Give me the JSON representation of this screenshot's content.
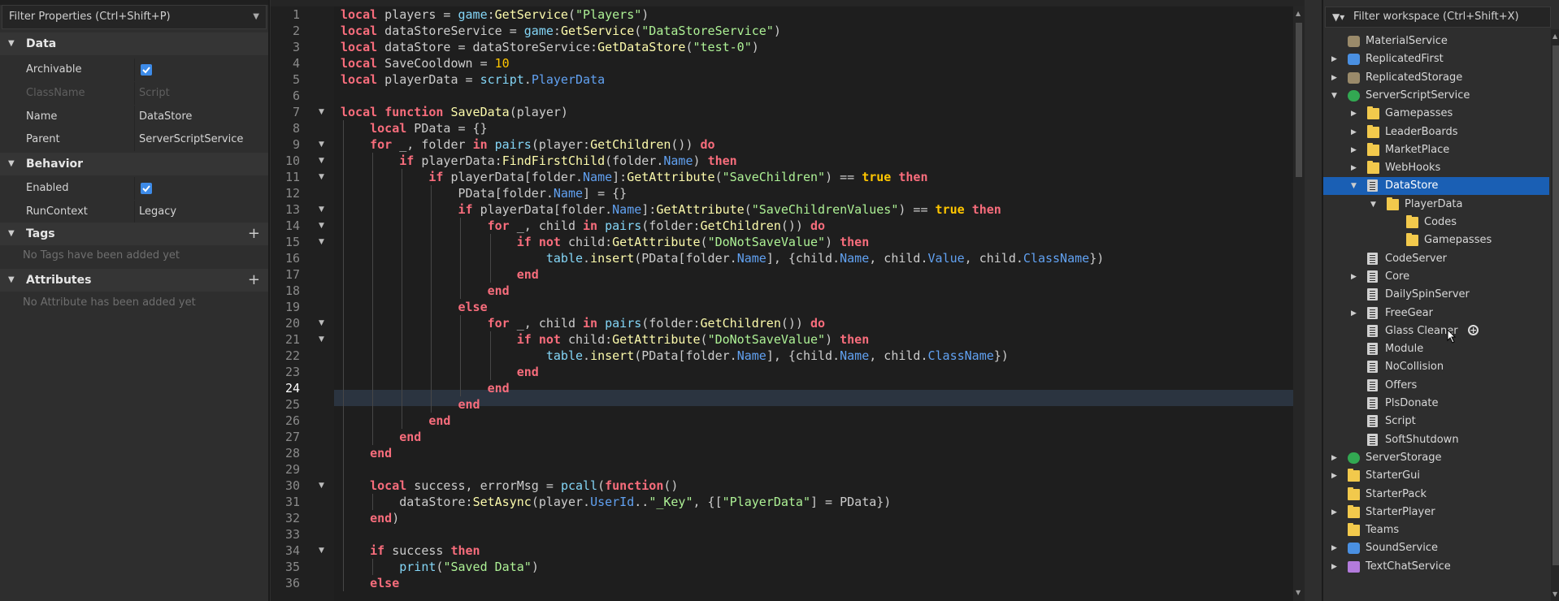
{
  "properties": {
    "filter_placeholder": "Filter Properties (Ctrl+Shift+P)",
    "sections": {
      "data": "Data",
      "behavior": "Behavior",
      "tags": "Tags",
      "attributes": "Attributes"
    },
    "rows": {
      "archivable": {
        "key": "Archivable",
        "checked": true
      },
      "classname": {
        "key": "ClassName",
        "value": "Script"
      },
      "name": {
        "key": "Name",
        "value": "DataStore"
      },
      "parent": {
        "key": "Parent",
        "value": "ServerScriptService"
      },
      "enabled": {
        "key": "Enabled",
        "checked": true
      },
      "runcontext": {
        "key": "RunContext",
        "value": "Legacy"
      }
    },
    "tags_empty": "No Tags have been added yet",
    "attributes_empty": "No Attribute has been added yet"
  },
  "editor": {
    "current_line": 24,
    "line_numbers": [
      "1",
      "2",
      "3",
      "4",
      "5",
      "6",
      "7",
      "8",
      "9",
      "10",
      "11",
      "12",
      "13",
      "14",
      "15",
      "16",
      "17",
      "18",
      "19",
      "20",
      "21",
      "22",
      "23",
      "24",
      "25",
      "26",
      "27",
      "28",
      "29",
      "30",
      "31",
      "32",
      "33",
      "34",
      "35",
      "36"
    ],
    "lines": [
      "local players = game:GetService(\"Players\")",
      "local dataStoreService = game:GetService(\"DataStoreService\")",
      "local dataStore = dataStoreService:GetDataStore(\"test-0\")",
      "local SaveCooldown = 10",
      "local playerData = script.PlayerData",
      "",
      "local function SaveData(player)",
      "    local PData = {}",
      "    for _, folder in pairs(player:GetChildren()) do",
      "        if playerData:FindFirstChild(folder.Name) then",
      "            if playerData[folder.Name]:GetAttribute(\"SaveChildren\") == true then",
      "                PData[folder.Name] = {}",
      "                if playerData[folder.Name]:GetAttribute(\"SaveChildrenValues\") == true then",
      "                    for _, child in pairs(folder:GetChildren()) do",
      "                        if not child:GetAttribute(\"DoNotSaveValue\") then",
      "                            table.insert(PData[folder.Name], {child.Name, child.Value, child.ClassName})",
      "                        end",
      "                    end",
      "                else",
      "                    for _, child in pairs(folder:GetChildren()) do",
      "                        if not child:GetAttribute(\"DoNotSaveValue\") then",
      "                            table.insert(PData[folder.Name], {child.Name, child.ClassName})",
      "                        end",
      "                    end",
      "                end",
      "            end",
      "        end",
      "    end",
      "",
      "    local success, errorMsg = pcall(function()",
      "        dataStore:SetAsync(player.UserId..\"_Key\", {[\"PlayerData\"] = PData})",
      "    end)",
      "",
      "    if success then",
      "        print(\"Saved Data\")",
      "    else"
    ]
  },
  "explorer": {
    "filter_placeholder": "Filter workspace (Ctrl+Shift+X)",
    "items": [
      {
        "label": "MaterialService",
        "depth": 0,
        "arrow": "",
        "icon": "service"
      },
      {
        "label": "ReplicatedFirst",
        "depth": 0,
        "arrow": "right",
        "icon": "blue"
      },
      {
        "label": "ReplicatedStorage",
        "depth": 0,
        "arrow": "right",
        "icon": "service"
      },
      {
        "label": "ServerScriptService",
        "depth": 0,
        "arrow": "down",
        "icon": "green"
      },
      {
        "label": "Gamepasses",
        "depth": 1,
        "arrow": "right",
        "icon": "folder"
      },
      {
        "label": "LeaderBoards",
        "depth": 1,
        "arrow": "right",
        "icon": "folder"
      },
      {
        "label": "MarketPlace",
        "depth": 1,
        "arrow": "right",
        "icon": "folder"
      },
      {
        "label": "WebHooks",
        "depth": 1,
        "arrow": "right",
        "icon": "folder"
      },
      {
        "label": "DataStore",
        "depth": 1,
        "arrow": "down",
        "icon": "script",
        "selected": true
      },
      {
        "label": "PlayerData",
        "depth": 2,
        "arrow": "down",
        "icon": "folder"
      },
      {
        "label": "Codes",
        "depth": 3,
        "arrow": "",
        "icon": "folder"
      },
      {
        "label": "Gamepasses",
        "depth": 3,
        "arrow": "",
        "icon": "folder"
      },
      {
        "label": "CodeServer",
        "depth": 1,
        "arrow": "",
        "icon": "script"
      },
      {
        "label": "Core",
        "depth": 1,
        "arrow": "right",
        "icon": "script"
      },
      {
        "label": "DailySpinServer",
        "depth": 1,
        "arrow": "",
        "icon": "script"
      },
      {
        "label": "FreeGear",
        "depth": 1,
        "arrow": "right",
        "icon": "script"
      },
      {
        "label": "Glass Cleaner",
        "depth": 1,
        "arrow": "",
        "icon": "script",
        "hover": true
      },
      {
        "label": "Module",
        "depth": 1,
        "arrow": "",
        "icon": "script"
      },
      {
        "label": "NoCollision",
        "depth": 1,
        "arrow": "",
        "icon": "script"
      },
      {
        "label": "Offers",
        "depth": 1,
        "arrow": "",
        "icon": "script"
      },
      {
        "label": "PlsDonate",
        "depth": 1,
        "arrow": "",
        "icon": "script"
      },
      {
        "label": "Script",
        "depth": 1,
        "arrow": "",
        "icon": "script"
      },
      {
        "label": "SoftShutdown",
        "depth": 1,
        "arrow": "",
        "icon": "script"
      },
      {
        "label": "ServerStorage",
        "depth": 0,
        "arrow": "right",
        "icon": "green"
      },
      {
        "label": "StarterGui",
        "depth": 0,
        "arrow": "right",
        "icon": "folder"
      },
      {
        "label": "StarterPack",
        "depth": 0,
        "arrow": "",
        "icon": "folder"
      },
      {
        "label": "StarterPlayer",
        "depth": 0,
        "arrow": "right",
        "icon": "folder"
      },
      {
        "label": "Teams",
        "depth": 0,
        "arrow": "",
        "icon": "folder"
      },
      {
        "label": "SoundService",
        "depth": 0,
        "arrow": "right",
        "icon": "blue"
      },
      {
        "label": "TextChatService",
        "depth": 0,
        "arrow": "right",
        "icon": "purple"
      }
    ]
  }
}
